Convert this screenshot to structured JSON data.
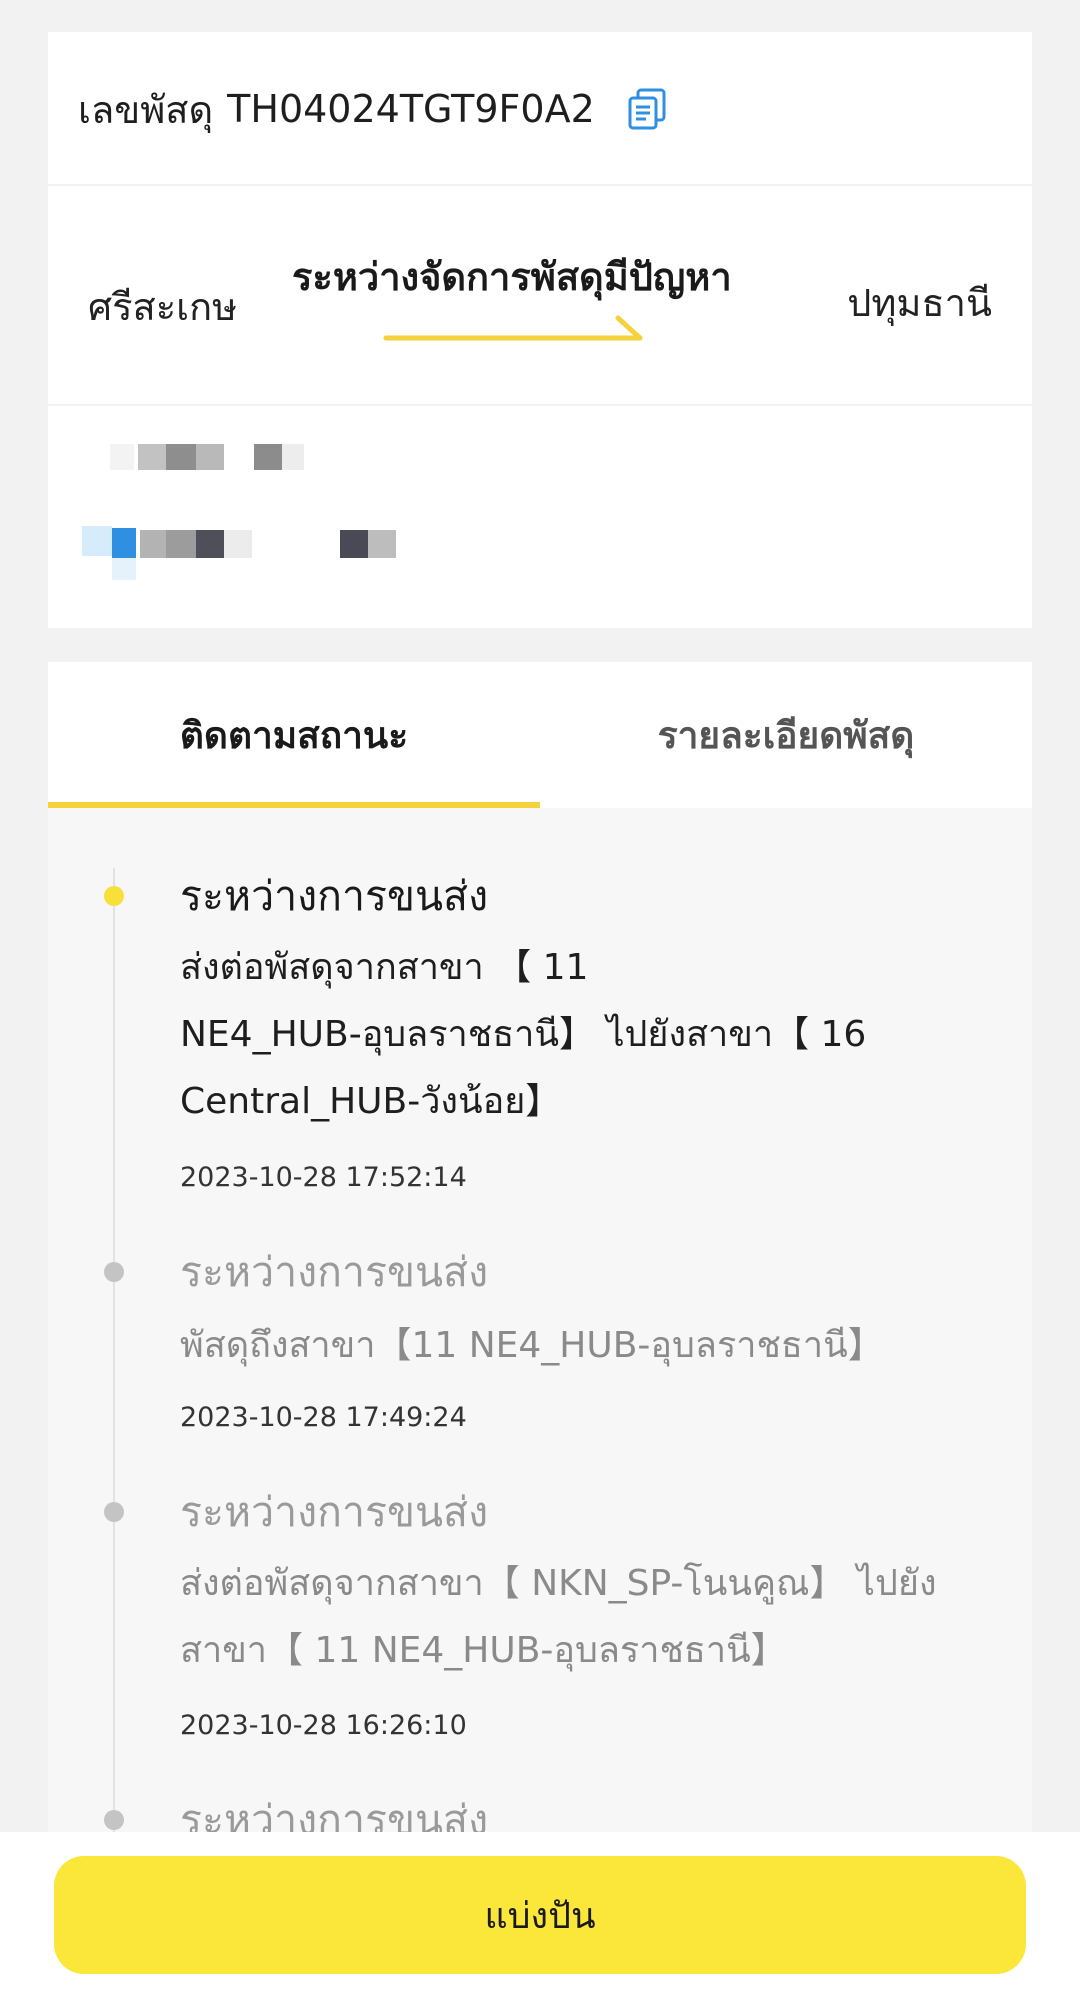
{
  "tracking": {
    "label": "เลขพัสดุ",
    "number": "TH04024TGT9F0A2"
  },
  "route": {
    "origin": "ศรีสะเกษ",
    "status": "ระหว่างจัดการพัสดุมีปัญหา",
    "destination": "ปทุมธานี"
  },
  "tabs": {
    "tracking_label": "ติดตามสถานะ",
    "details_label": "รายละเอียดพัสดุ"
  },
  "timeline": [
    {
      "title": "ระหว่างการขนส่ง",
      "lines": [
        "ส่งต่อพัสดุจากสาขา 【 11",
        "NE4_HUB-อุบลราชธานี】 ไปยังสาขา【 16",
        "Central_HUB-วังน้อย】"
      ],
      "time": "2023-10-28 17:52:14"
    },
    {
      "title": "ระหว่างการขนส่ง",
      "lines": [
        "พัสดุถึงสาขา【11 NE4_HUB-อุบลราชธานี】"
      ],
      "time": "2023-10-28 17:49:24"
    },
    {
      "title": "ระหว่างการขนส่ง",
      "lines": [
        "ส่งต่อพัสดุจากสาขา【 NKN_SP-โนนคูณ】 ไปยัง",
        "สาขา【 11 NE4_HUB-อุบลราชธานี】"
      ],
      "time": "2023-10-28 16:26:10"
    },
    {
      "title": "ระหว่างการขนส่ง"
    }
  ],
  "bottom": {
    "share_label": "แบ่งปัน"
  },
  "colors": {
    "accent": "#fbe73a",
    "tab_underline": "#f5d23c",
    "copy_icon": "#2f8fe0"
  }
}
